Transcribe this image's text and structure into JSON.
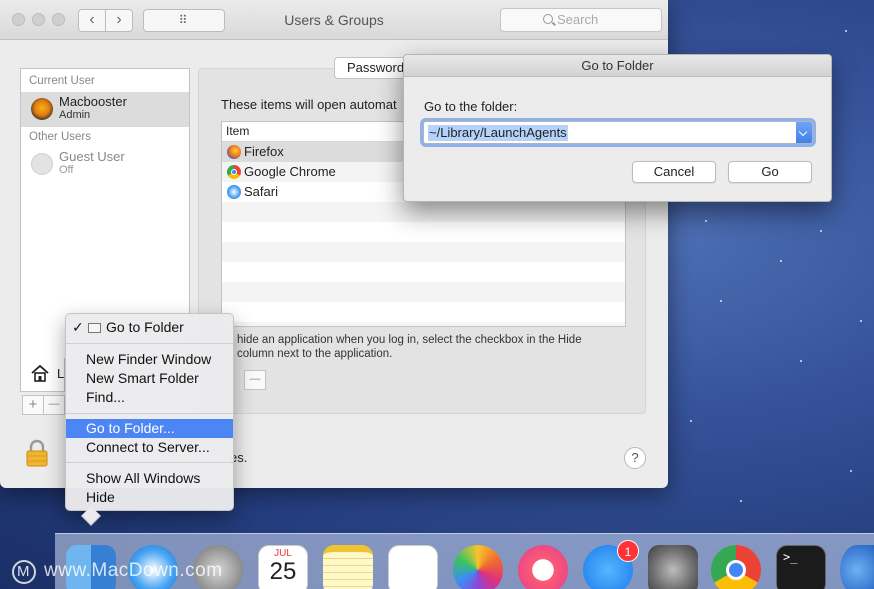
{
  "window": {
    "title": "Users & Groups",
    "search_placeholder": "Search",
    "back_glyph": "‹",
    "forward_glyph": "›",
    "grid_glyph": "⠿"
  },
  "users": {
    "current_user_label": "Current User",
    "current_user": {
      "name": "Macbooster",
      "role": "Admin"
    },
    "other_users_label": "Other Users",
    "other_users": [
      {
        "name": "Guest User",
        "status": "Off"
      }
    ],
    "home_label": "L",
    "add_glyph": "+",
    "remove_glyph": "—"
  },
  "login_items": {
    "tab_label": "Password",
    "intro": "These items will open automat",
    "column_header": "Item",
    "items": [
      {
        "name": "Firefox",
        "icon": "firefox-icon"
      },
      {
        "name": "Google Chrome",
        "icon": "chrome-icon"
      },
      {
        "name": "Safari",
        "icon": "safari-icon"
      }
    ],
    "hide_note": "hide an application when you log in, select the checkbox in the Hide column next to the application.",
    "remove_glyph": "—",
    "lock_text": "es.",
    "help_glyph": "?"
  },
  "dialog": {
    "title": "Go to Folder",
    "label": "Go to the folder:",
    "path_value": "~/Library/LaunchAgents",
    "cancel_label": "Cancel",
    "go_label": "Go"
  },
  "context_menu": {
    "header_item": "Go to Folder",
    "check_glyph": "✓",
    "group1": [
      "New Finder Window",
      "New Smart Folder",
      "Find..."
    ],
    "group2": [
      "Go to Folder...",
      "Connect to Server..."
    ],
    "group3": [
      "Show All Windows",
      "Hide"
    ],
    "highlighted": "Go to Folder..."
  },
  "dock": {
    "calendar_month": "JUL",
    "calendar_day": "25",
    "appstore_badge": "1",
    "terminal_glyph": ">_"
  },
  "watermark": {
    "text": "www.MacDown.com",
    "logo_letter": "M"
  },
  "colors": {
    "selection_blue": "#4c86f4",
    "focus_ring": "#5d92e5",
    "badge_red": "#ff3333",
    "desktop_blue": "#2e4a8c"
  }
}
